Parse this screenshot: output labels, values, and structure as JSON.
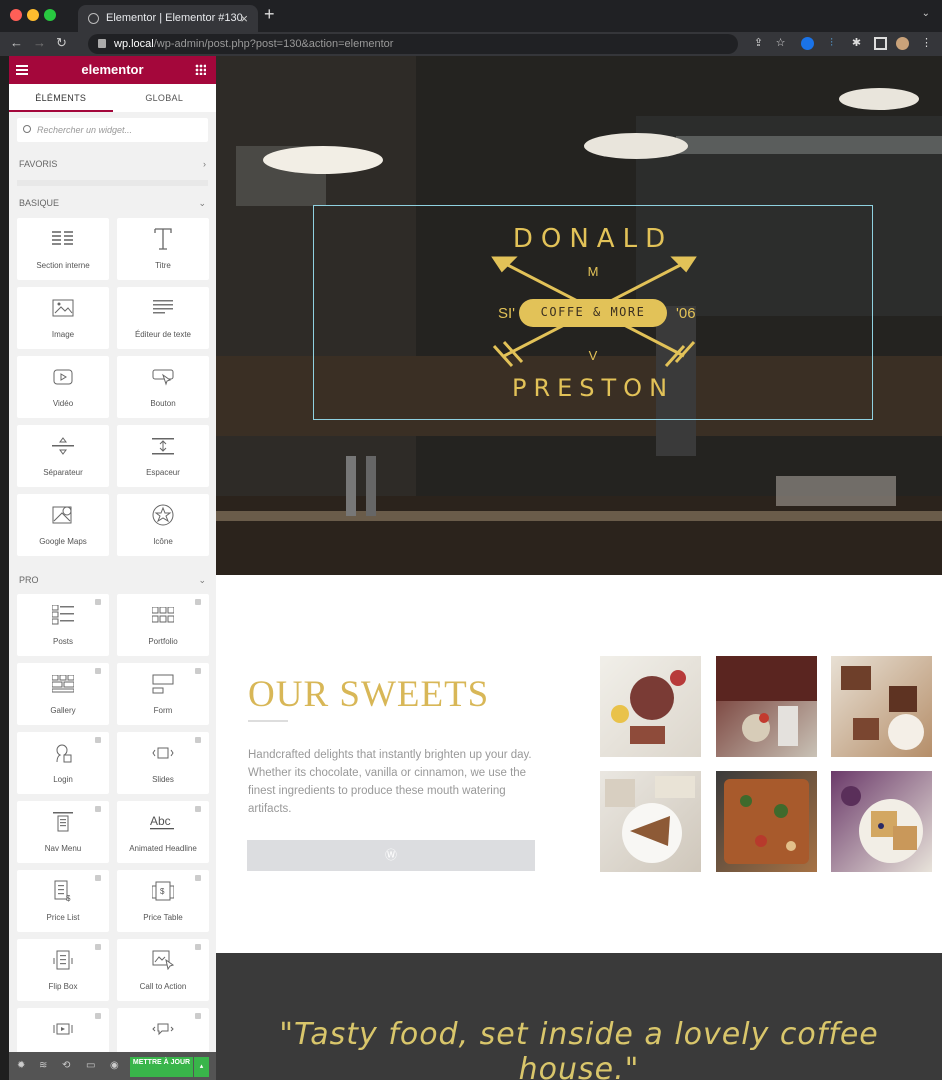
{
  "browser": {
    "tab_title": "Elementor | Elementor #130",
    "url_domain": "wp.local",
    "url_path": "/wp-admin/post.php?post=130&action=elementor"
  },
  "elementor": {
    "logo": "elementor",
    "tabs": [
      "ÉLÉMENTS",
      "GLOBAL"
    ],
    "search_placeholder": "Rechercher un widget...",
    "categories": {
      "favoris": "FAVORIS",
      "basique": "BASIQUE",
      "pro": "PRO"
    },
    "basic_widgets": [
      {
        "label": "Section interne",
        "icon": "columns-icon"
      },
      {
        "label": "Titre",
        "icon": "heading-icon"
      },
      {
        "label": "Image",
        "icon": "image-icon"
      },
      {
        "label": "Éditeur de texte",
        "icon": "text-editor-icon"
      },
      {
        "label": "Vidéo",
        "icon": "video-icon"
      },
      {
        "label": "Bouton",
        "icon": "button-icon"
      },
      {
        "label": "Séparateur",
        "icon": "divider-icon"
      },
      {
        "label": "Espaceur",
        "icon": "spacer-icon"
      },
      {
        "label": "Google Maps",
        "icon": "map-icon"
      },
      {
        "label": "Icône",
        "icon": "star-icon"
      }
    ],
    "pro_widgets": [
      {
        "label": "Posts",
        "icon": "posts-icon"
      },
      {
        "label": "Portfolio",
        "icon": "portfolio-icon"
      },
      {
        "label": "Gallery",
        "icon": "gallery-icon"
      },
      {
        "label": "Form",
        "icon": "form-icon"
      },
      {
        "label": "Login",
        "icon": "login-icon"
      },
      {
        "label": "Slides",
        "icon": "slides-icon"
      },
      {
        "label": "Nav Menu",
        "icon": "nav-menu-icon"
      },
      {
        "label": "Animated Headline",
        "icon": "animated-headline-icon"
      },
      {
        "label": "Price List",
        "icon": "price-list-icon"
      },
      {
        "label": "Price Table",
        "icon": "price-table-icon"
      },
      {
        "label": "Flip Box",
        "icon": "flip-box-icon"
      },
      {
        "label": "Call to Action",
        "icon": "call-to-action-icon"
      },
      {
        "label": "",
        "icon": "media-carousel-icon"
      },
      {
        "label": "",
        "icon": "testimonial-icon"
      }
    ],
    "update_button": "METTRE À JOUR"
  },
  "hero_logo": {
    "top_word": "DONALD",
    "middle_letter_top": "M",
    "left": "SI'",
    "banner": "COFFE & MORE",
    "right": "'06",
    "middle_letter_bottom": "V",
    "bottom_word": "PRESTON"
  },
  "sweets": {
    "title": "OUR SWEETS",
    "text": "Handcrafted delights that instantly brighten up your day. Whether its chocolate, vanilla or cinnamon, we use the finest ingredients to produce these mouth watering artifacts."
  },
  "quote": "\"Tasty food, set inside a lovely coffee house.\"",
  "colors": {
    "elementor_brand": "#a4073b",
    "gold": "#d8b757",
    "update_green": "#39b54a"
  }
}
